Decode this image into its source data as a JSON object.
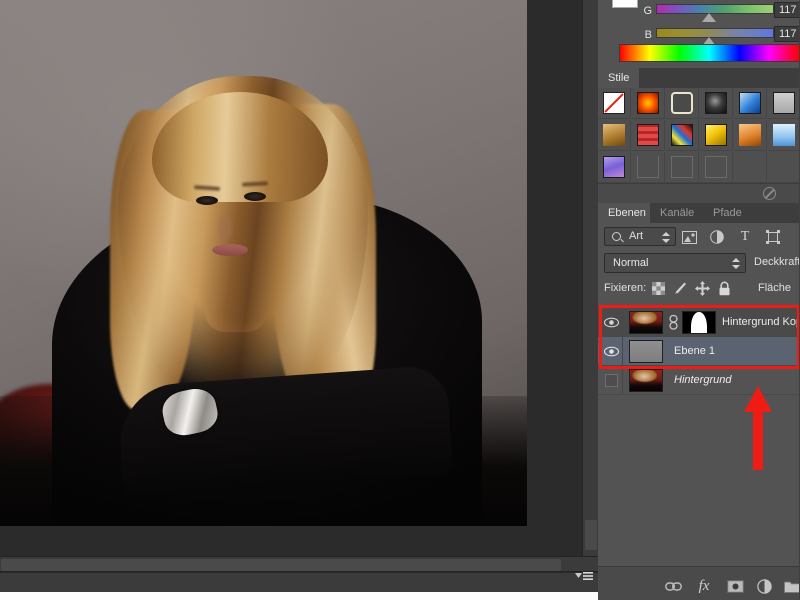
{
  "app": {
    "name": "Adobe Photoshop",
    "locale": "de"
  },
  "color_panel": {
    "sliders": [
      {
        "channel": "G",
        "value": "117"
      },
      {
        "channel": "B",
        "value": "117"
      }
    ],
    "foreground_swatch": "#ffffff"
  },
  "styles_panel": {
    "tab_label": "Stile",
    "delete_icon": "no-entry-icon",
    "swatches": [
      "none",
      "#ff4a10",
      "selected-outline",
      "#3a3a3a",
      "#2f7fd8",
      "#b8b8b8",
      "#cfcfcf",
      "#b98a2e",
      "#e03a3a",
      "#f2d23a",
      "#f3c40c",
      "#e0832a",
      "#7fb8ee",
      "#8ec3f0",
      "#8b6fd8",
      "empty",
      "empty",
      "empty"
    ]
  },
  "layers_panel": {
    "tabs": [
      {
        "label": "Ebenen",
        "active": true
      },
      {
        "label": "Kanäle",
        "active": false
      },
      {
        "label": "Pfade",
        "active": false
      }
    ],
    "filter": {
      "icon": "search-icon",
      "value": "Art",
      "stepper_icon": "updown-arrows-icon",
      "type_icons": [
        "image-filter-icon",
        "adjustment-filter-icon",
        "type-filter-icon",
        "shape-filter-icon"
      ]
    },
    "blend": {
      "mode": "Normal",
      "opacity_label": "Deckkraft"
    },
    "lock": {
      "label": "Fixieren:",
      "icons": [
        "lock-transparency-icon",
        "lock-image-icon",
        "lock-position-icon",
        "lock-all-icon"
      ],
      "fill_label": "Fläche"
    },
    "selection_highlight_color": "#ee1c14",
    "layers": [
      {
        "name": "Hintergrund Kopi",
        "visible": true,
        "visibility_icon": "eye-icon",
        "thumbnail": "photo-thumbnail",
        "link_icon": "link-mask-icon",
        "mask_thumbnail": "layer-mask-thumbnail",
        "selected": true,
        "italic": false
      },
      {
        "name": "Ebene 1",
        "visible": true,
        "visibility_icon": "eye-icon",
        "thumbnail": "gray-fill-thumbnail",
        "selected": true,
        "active": true,
        "italic": false
      },
      {
        "name": "Hintergrund",
        "visible": false,
        "visibility_icon": "eye-off-icon",
        "thumbnail": "photo-thumbnail",
        "selected": false,
        "italic": true
      }
    ],
    "toolbar_buttons": [
      {
        "name": "link-layers-button",
        "icon": "link-icon"
      },
      {
        "name": "layer-style-button",
        "icon": "fx-icon"
      },
      {
        "name": "add-layer-mask-button",
        "icon": "mask-icon"
      },
      {
        "name": "new-adjustment-layer-button",
        "icon": "half-circle-icon"
      },
      {
        "name": "new-group-button",
        "icon": "folder-icon"
      }
    ]
  },
  "document": {
    "image_alt": "Portrait of a blonde woman in a black top leaning on her arms",
    "scroll_menu_icon": "panel-menu-icon"
  },
  "annotation": {
    "arrow": {
      "color": "#ee1c14",
      "direction": "up",
      "points_at": "Hintergrund layer row"
    }
  }
}
